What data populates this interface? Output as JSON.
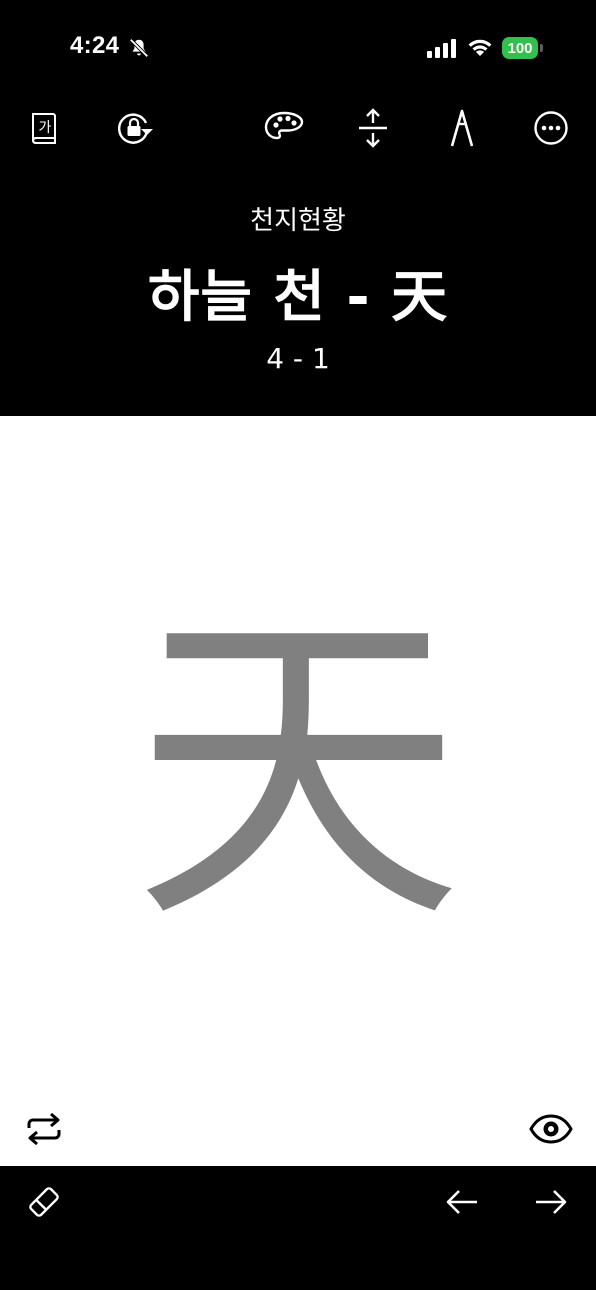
{
  "status_bar": {
    "time": "4:24",
    "battery": "100",
    "battery_color": "#30c04b",
    "icons": [
      "bell-slash-icon",
      "cellular-signal-icon",
      "wifi-icon",
      "battery-icon"
    ]
  },
  "toolbar": {
    "buttons": [
      {
        "name": "dictionary-button",
        "icon": "book-ga-icon"
      },
      {
        "name": "rotation-lock-button",
        "icon": "rotation-lock-icon"
      },
      {
        "name": "color-palette-button",
        "icon": "palette-icon"
      },
      {
        "name": "vertical-resize-button",
        "icon": "vertical-resize-icon"
      },
      {
        "name": "pen-button",
        "icon": "pen-nib-icon"
      },
      {
        "name": "more-button",
        "icon": "ellipsis-circle-icon"
      }
    ],
    "dictionary_icon_text": "가"
  },
  "header": {
    "subtitle": "천지현황",
    "title": "하늘 천 - 天",
    "page_counter": "4 - 1"
  },
  "canvas": {
    "character": "天",
    "character_color": "#808080",
    "background": "#ffffff"
  },
  "canvas_controls": {
    "left_icon": "repeat-icon",
    "right_icon": "eye-icon"
  },
  "bottom_bar": {
    "left_icon": "eraser-icon",
    "prev_icon": "arrow-left-icon",
    "next_icon": "arrow-right-icon"
  }
}
